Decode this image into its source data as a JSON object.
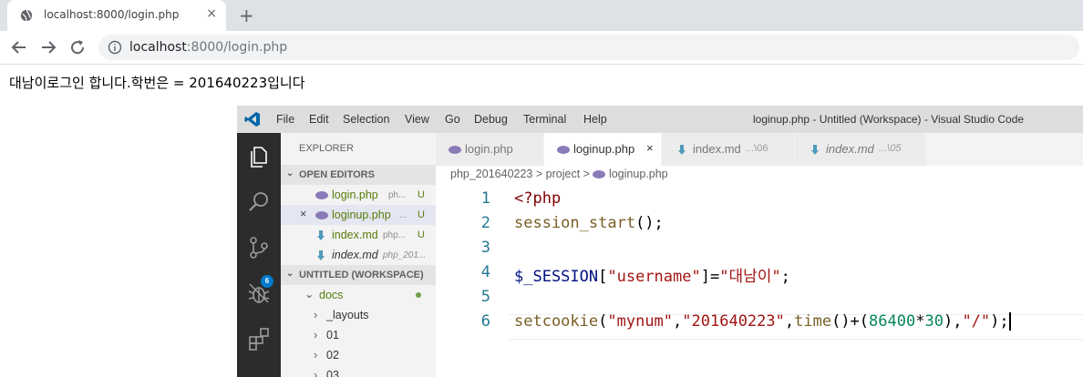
{
  "browser": {
    "tab_title": "localhost:8000/login.php",
    "close_glyph": "×",
    "new_tab_glyph": "+",
    "url_host": "localhost",
    "url_path": ":8000/login.php"
  },
  "page": {
    "text": "대남이로그인 합니다.학번은 = 201640223입니다"
  },
  "vscode": {
    "menu": [
      "File",
      "Edit",
      "Selection",
      "View",
      "Go",
      "Debug",
      "Terminal",
      "Help"
    ],
    "window_title": "loginup.php - Untitled (Workspace) - Visual Studio Code",
    "badge_count": "6",
    "sidebar": {
      "header": "EXPLORER",
      "open_editors_label": "OPEN EDITORS",
      "open_editors": [
        {
          "name": "login.php",
          "desc": "ph...",
          "status": "U"
        },
        {
          "name": "loginup.php",
          "desc": "...",
          "status": "U",
          "close": "×"
        },
        {
          "name": "index.md",
          "desc": "php...",
          "status": "U"
        },
        {
          "name": "index.md",
          "desc": "php_201...",
          "status": ""
        }
      ],
      "workspace_label": "UNTITLED (WORKSPACE)",
      "tree": [
        {
          "name": "docs"
        },
        {
          "name": "_layouts"
        },
        {
          "name": "01"
        },
        {
          "name": "02"
        },
        {
          "name": "03"
        }
      ]
    },
    "tabs": [
      {
        "label": "login.php",
        "desc": ""
      },
      {
        "label": "loginup.php",
        "desc": "",
        "close": "×"
      },
      {
        "label": "index.md",
        "desc": "...\\06"
      },
      {
        "label": "index.md",
        "desc": "...\\05"
      }
    ],
    "breadcrumb": {
      "parts": [
        "php_201640223",
        "project",
        "loginup.php"
      ],
      "sep": ">"
    },
    "code": {
      "line_numbers": [
        "1",
        "2",
        "3",
        "4",
        "5",
        "6"
      ],
      "l1": "<?php",
      "l2_fn": "session_start",
      "l2_rest": "();",
      "l4_var": "$_SESSION",
      "l4_b1": "[",
      "l4_key": "\"username\"",
      "l4_b2": "]=",
      "l4_val": "\"대남이\"",
      "l4_end": ";",
      "l6_fn": "setcookie",
      "l6_p1": "(",
      "l6_s1": "\"mynum\"",
      "l6_c1": ",",
      "l6_s2": "\"201640223\"",
      "l6_c2": ",",
      "l6_fn2": "time",
      "l6_p2": "()+(",
      "l6_n1": "86400",
      "l6_op": "*",
      "l6_n2": "30",
      "l6_p3": "),",
      "l6_s3": "\"/\"",
      "l6_end": ");"
    }
  }
}
